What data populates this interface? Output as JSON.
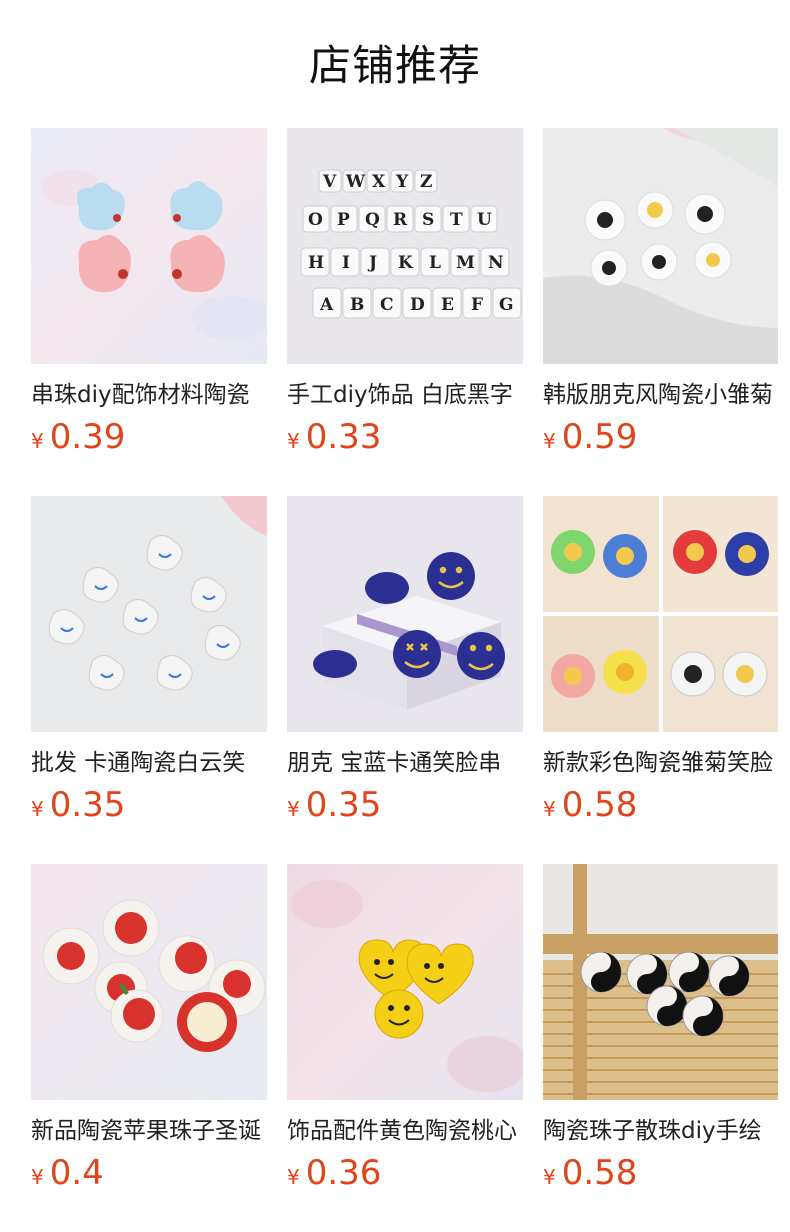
{
  "header": {
    "title": "店铺推荐"
  },
  "products": [
    {
      "name": "串珠diy配饰材料陶瓷",
      "currency": "¥",
      "price": "0.39",
      "image_icon": "pastel-ceramic-rabbit-beads-icon"
    },
    {
      "name": "手工diy饰品 白底黑字",
      "currency": "¥",
      "price": "0.33",
      "image_icon": "letter-cube-beads-icon"
    },
    {
      "name": "韩版朋克风陶瓷小雏菊",
      "currency": "¥",
      "price": "0.59",
      "image_icon": "white-smiley-flower-beads-icon"
    },
    {
      "name": "批发 卡通陶瓷白云笑",
      "currency": "¥",
      "price": "0.35",
      "image_icon": "white-cloud-smiley-beads-icon"
    },
    {
      "name": "朋克 宝蓝卡通笑脸串",
      "currency": "¥",
      "price": "0.35",
      "image_icon": "blue-smiley-beads-icon"
    },
    {
      "name": "新款彩色陶瓷雏菊笑脸",
      "currency": "¥",
      "price": "0.58",
      "image_icon": "colorful-daisy-smiley-beads-icon"
    },
    {
      "name": "新品陶瓷苹果珠子圣诞",
      "currency": "¥",
      "price": "0.4",
      "image_icon": "apple-ceramic-beads-icon"
    },
    {
      "name": "饰品配件黄色陶瓷桃心",
      "currency": "¥",
      "price": "0.36",
      "image_icon": "yellow-heart-smiley-beads-icon"
    },
    {
      "name": "陶瓷珠子散珠diy手绘",
      "currency": "¥",
      "price": "0.58",
      "image_icon": "yin-yang-beads-icon"
    }
  ],
  "colors": {
    "price": "#e0441a",
    "title": "#111111",
    "text": "#222222"
  }
}
